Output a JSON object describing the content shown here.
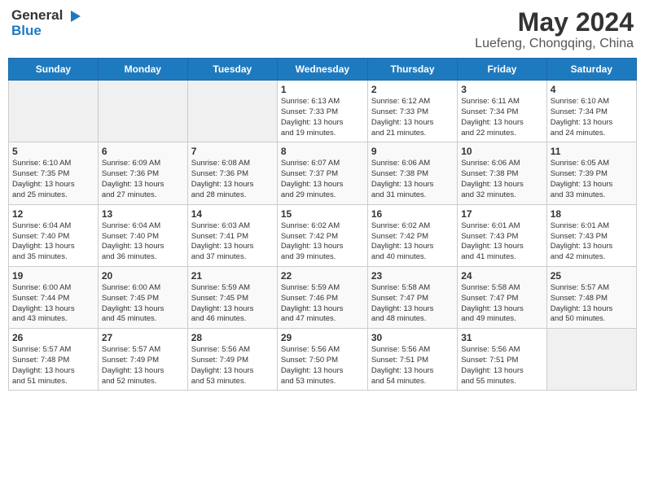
{
  "header": {
    "logo_general": "General",
    "logo_blue": "Blue",
    "main_title": "May 2024",
    "subtitle": "Luefeng, Chongqing, China"
  },
  "calendar": {
    "days_of_week": [
      "Sunday",
      "Monday",
      "Tuesday",
      "Wednesday",
      "Thursday",
      "Friday",
      "Saturday"
    ],
    "weeks": [
      [
        {
          "day": "",
          "content": ""
        },
        {
          "day": "",
          "content": ""
        },
        {
          "day": "",
          "content": ""
        },
        {
          "day": "1",
          "content": "Sunrise: 6:13 AM\nSunset: 7:33 PM\nDaylight: 13 hours\nand 19 minutes."
        },
        {
          "day": "2",
          "content": "Sunrise: 6:12 AM\nSunset: 7:33 PM\nDaylight: 13 hours\nand 21 minutes."
        },
        {
          "day": "3",
          "content": "Sunrise: 6:11 AM\nSunset: 7:34 PM\nDaylight: 13 hours\nand 22 minutes."
        },
        {
          "day": "4",
          "content": "Sunrise: 6:10 AM\nSunset: 7:34 PM\nDaylight: 13 hours\nand 24 minutes."
        }
      ],
      [
        {
          "day": "5",
          "content": "Sunrise: 6:10 AM\nSunset: 7:35 PM\nDaylight: 13 hours\nand 25 minutes."
        },
        {
          "day": "6",
          "content": "Sunrise: 6:09 AM\nSunset: 7:36 PM\nDaylight: 13 hours\nand 27 minutes."
        },
        {
          "day": "7",
          "content": "Sunrise: 6:08 AM\nSunset: 7:36 PM\nDaylight: 13 hours\nand 28 minutes."
        },
        {
          "day": "8",
          "content": "Sunrise: 6:07 AM\nSunset: 7:37 PM\nDaylight: 13 hours\nand 29 minutes."
        },
        {
          "day": "9",
          "content": "Sunrise: 6:06 AM\nSunset: 7:38 PM\nDaylight: 13 hours\nand 31 minutes."
        },
        {
          "day": "10",
          "content": "Sunrise: 6:06 AM\nSunset: 7:38 PM\nDaylight: 13 hours\nand 32 minutes."
        },
        {
          "day": "11",
          "content": "Sunrise: 6:05 AM\nSunset: 7:39 PM\nDaylight: 13 hours\nand 33 minutes."
        }
      ],
      [
        {
          "day": "12",
          "content": "Sunrise: 6:04 AM\nSunset: 7:40 PM\nDaylight: 13 hours\nand 35 minutes."
        },
        {
          "day": "13",
          "content": "Sunrise: 6:04 AM\nSunset: 7:40 PM\nDaylight: 13 hours\nand 36 minutes."
        },
        {
          "day": "14",
          "content": "Sunrise: 6:03 AM\nSunset: 7:41 PM\nDaylight: 13 hours\nand 37 minutes."
        },
        {
          "day": "15",
          "content": "Sunrise: 6:02 AM\nSunset: 7:42 PM\nDaylight: 13 hours\nand 39 minutes."
        },
        {
          "day": "16",
          "content": "Sunrise: 6:02 AM\nSunset: 7:42 PM\nDaylight: 13 hours\nand 40 minutes."
        },
        {
          "day": "17",
          "content": "Sunrise: 6:01 AM\nSunset: 7:43 PM\nDaylight: 13 hours\nand 41 minutes."
        },
        {
          "day": "18",
          "content": "Sunrise: 6:01 AM\nSunset: 7:43 PM\nDaylight: 13 hours\nand 42 minutes."
        }
      ],
      [
        {
          "day": "19",
          "content": "Sunrise: 6:00 AM\nSunset: 7:44 PM\nDaylight: 13 hours\nand 43 minutes."
        },
        {
          "day": "20",
          "content": "Sunrise: 6:00 AM\nSunset: 7:45 PM\nDaylight: 13 hours\nand 45 minutes."
        },
        {
          "day": "21",
          "content": "Sunrise: 5:59 AM\nSunset: 7:45 PM\nDaylight: 13 hours\nand 46 minutes."
        },
        {
          "day": "22",
          "content": "Sunrise: 5:59 AM\nSunset: 7:46 PM\nDaylight: 13 hours\nand 47 minutes."
        },
        {
          "day": "23",
          "content": "Sunrise: 5:58 AM\nSunset: 7:47 PM\nDaylight: 13 hours\nand 48 minutes."
        },
        {
          "day": "24",
          "content": "Sunrise: 5:58 AM\nSunset: 7:47 PM\nDaylight: 13 hours\nand 49 minutes."
        },
        {
          "day": "25",
          "content": "Sunrise: 5:57 AM\nSunset: 7:48 PM\nDaylight: 13 hours\nand 50 minutes."
        }
      ],
      [
        {
          "day": "26",
          "content": "Sunrise: 5:57 AM\nSunset: 7:48 PM\nDaylight: 13 hours\nand 51 minutes."
        },
        {
          "day": "27",
          "content": "Sunrise: 5:57 AM\nSunset: 7:49 PM\nDaylight: 13 hours\nand 52 minutes."
        },
        {
          "day": "28",
          "content": "Sunrise: 5:56 AM\nSunset: 7:49 PM\nDaylight: 13 hours\nand 53 minutes."
        },
        {
          "day": "29",
          "content": "Sunrise: 5:56 AM\nSunset: 7:50 PM\nDaylight: 13 hours\nand 53 minutes."
        },
        {
          "day": "30",
          "content": "Sunrise: 5:56 AM\nSunset: 7:51 PM\nDaylight: 13 hours\nand 54 minutes."
        },
        {
          "day": "31",
          "content": "Sunrise: 5:56 AM\nSunset: 7:51 PM\nDaylight: 13 hours\nand 55 minutes."
        },
        {
          "day": "",
          "content": ""
        }
      ]
    ]
  }
}
